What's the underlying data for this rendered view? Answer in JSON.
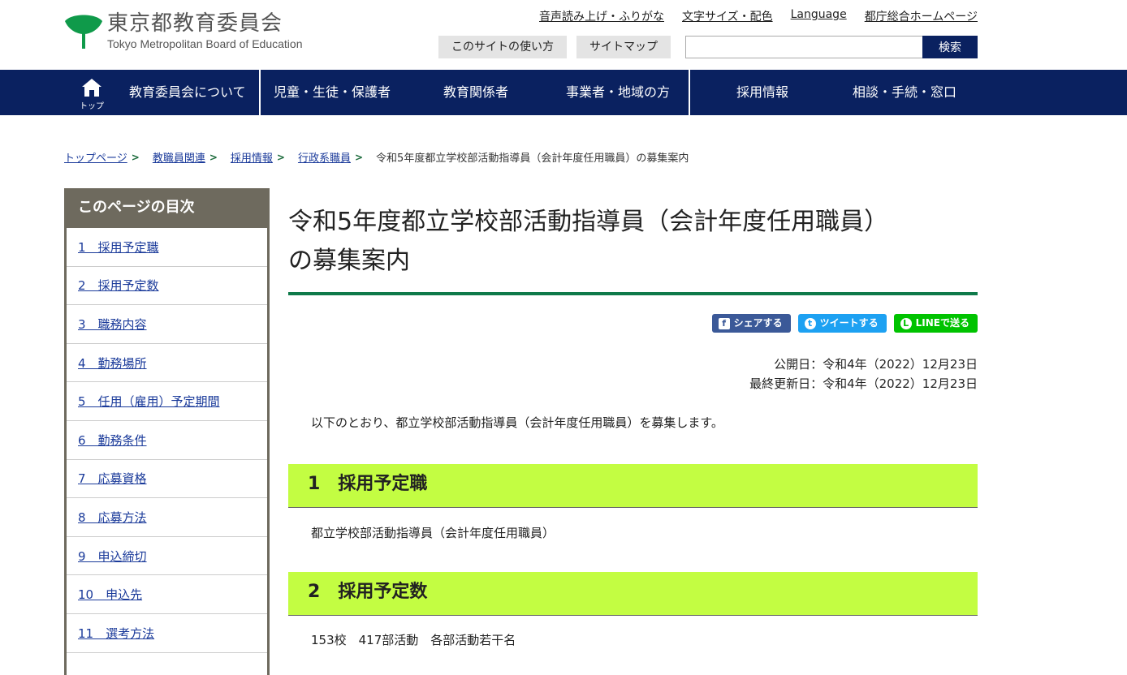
{
  "header": {
    "logo_jp": "東京都教育委員会",
    "logo_en": "Tokyo Metropolitan Board of Education",
    "util_links": [
      "音声読み上げ・ふりがな",
      "文字サイズ・配色",
      "Language",
      "都庁総合ホームページ"
    ],
    "sub_buttons": [
      "このサイトの使い方",
      "サイトマップ"
    ],
    "search": {
      "value": "",
      "button": "検索"
    }
  },
  "gnav": {
    "home_label": "トップ",
    "items": [
      "教育委員会について",
      "児童・生徒・保護者",
      "教育関係者",
      "事業者・地域の方",
      "採用情報",
      "相談・手続・窓口"
    ]
  },
  "breadcrumb": {
    "links": [
      "トップページ",
      "教職員関連",
      "採用情報",
      "行政系職員"
    ],
    "current": "令和5年度都立学校部活動指導員（会計年度任用職員）の募集案内"
  },
  "toc": {
    "heading": "このページの目次",
    "items": [
      "1　採用予定職",
      "2　採用予定数",
      "3　職務内容",
      "4　勤務場所",
      "5　任用（雇用）予定期間",
      "6　勤務条件",
      "7　応募資格",
      "8　応募方法",
      "9　申込締切",
      "10　申込先",
      "11　選考方法"
    ]
  },
  "main": {
    "title_line1": "令和5年度都立学校部活動指導員（会計年度任用職員）",
    "title_line2": "の募集案内",
    "share": {
      "facebook": "シェアする",
      "twitter": "ツイートする",
      "line": "LINEで送る"
    },
    "published": "公開日：令和4年（2022）12月23日",
    "updated": "最終更新日：令和4年（2022）12月23日",
    "intro": "以下のとおり、都立学校部活動指導員（会計年度任用職員）を募集します。",
    "sections": [
      {
        "num": "1",
        "title": "採用予定職",
        "body": "都立学校部活動指導員（会計年度任用職員）"
      },
      {
        "num": "2",
        "title": "採用予定数",
        "body": "153校　417部活動　各部活動若干名"
      }
    ]
  },
  "colors": {
    "nav": "#0a2160",
    "section": "#c3fd42",
    "rule": "#0f7a4a",
    "toc_head": "#6e6a5e"
  }
}
